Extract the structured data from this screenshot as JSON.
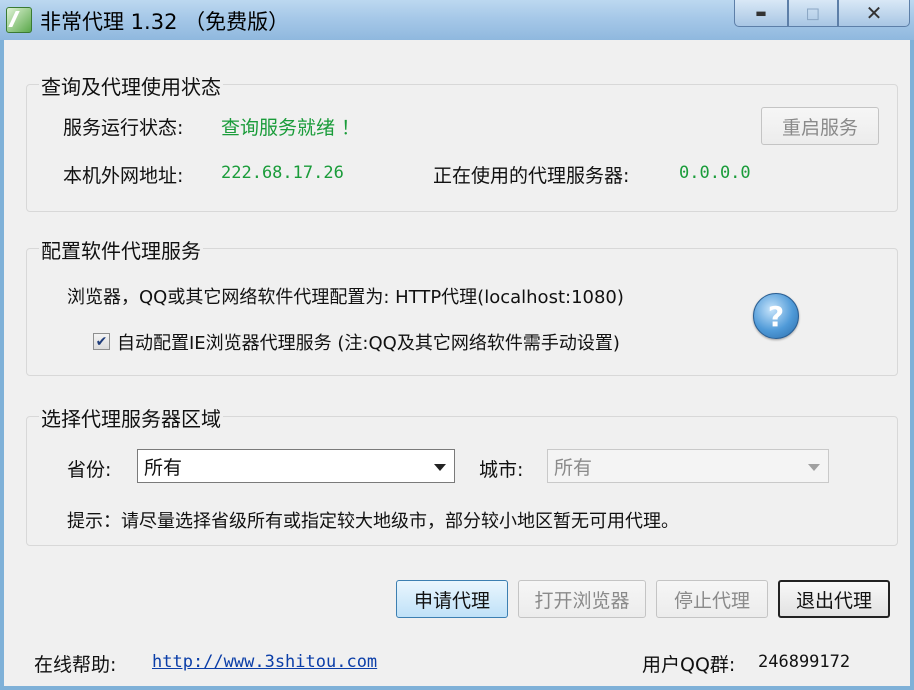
{
  "window": {
    "title": "非常代理 1.32 （免费版）",
    "icon": "app-logo-icon",
    "controls": {
      "minimize": "▬",
      "maximize": "◻",
      "close": "✕"
    }
  },
  "status": {
    "group_title": "查询及代理使用状态",
    "service_state_label": "服务运行状态:",
    "service_state_value": "查询服务就绪 ！",
    "external_ip_label": "本机外网地址:",
    "external_ip_value": "222.68.17.26",
    "proxy_in_use_label": "正在使用的代理服务器:",
    "proxy_in_use_value": "0.0.0.0",
    "restart_button": "重启服务"
  },
  "config": {
    "group_title": "配置软件代理服务",
    "info_text": "浏览器，QQ或其它网络软件代理配置为: HTTP代理(localhost:1080)",
    "auto_config_label": "自动配置IE浏览器代理服务 (注:QQ及其它网络软件需手动设置)",
    "auto_config_checked": true,
    "help_icon_glyph": "?"
  },
  "region": {
    "group_title": "选择代理服务器区域",
    "province_label": "省份:",
    "province_value": "所有",
    "city_label": "城市:",
    "city_value": "所有",
    "hint": "提示：请尽量选择省级所有或指定较大地级市，部分较小地区暂无可用代理。"
  },
  "actions": {
    "request_proxy": "申请代理",
    "open_browser": "打开浏览器",
    "stop_proxy": "停止代理",
    "exit_proxy": "退出代理"
  },
  "footer": {
    "help_label": "在线帮助:",
    "help_url": "http://www.3shitou.com",
    "qq_group_label": "用户QQ群:",
    "qq_group_value": "246899172"
  },
  "colors": {
    "status_green": "#1a9c3a",
    "link_blue": "#0b3ea8",
    "titlebar_blue": "#a6c8e8"
  }
}
